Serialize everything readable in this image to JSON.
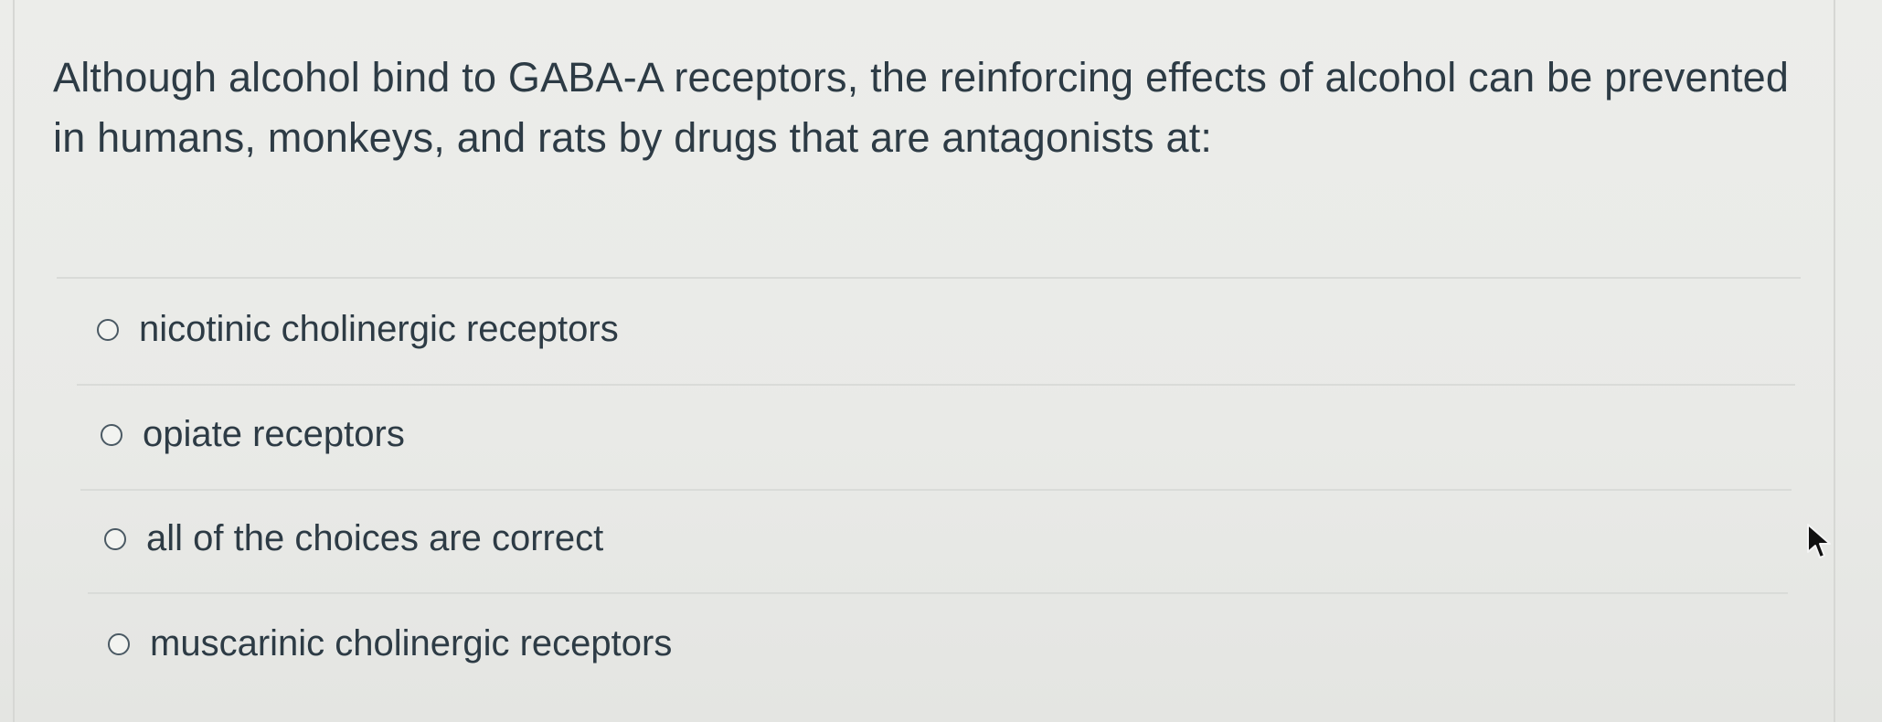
{
  "question": {
    "text": "Although alcohol bind to GABA-A receptors, the reinforcing effects of alcohol can be prevented in humans, monkeys, and rats by drugs that are antagonists at:"
  },
  "options": [
    {
      "label": "nicotinic cholinergic receptors",
      "selected": false
    },
    {
      "label": "opiate receptors",
      "selected": false
    },
    {
      "label": "all of the choices are correct",
      "selected": false
    },
    {
      "label": "muscarinic cholinergic receptors",
      "selected": false
    }
  ],
  "icons": {
    "radio": "radio-button-icon",
    "cursor": "mouse-pointer-icon"
  },
  "colors": {
    "text": "#2d3b45",
    "divider": "#d9dbd8",
    "background": "#e9eae7"
  }
}
